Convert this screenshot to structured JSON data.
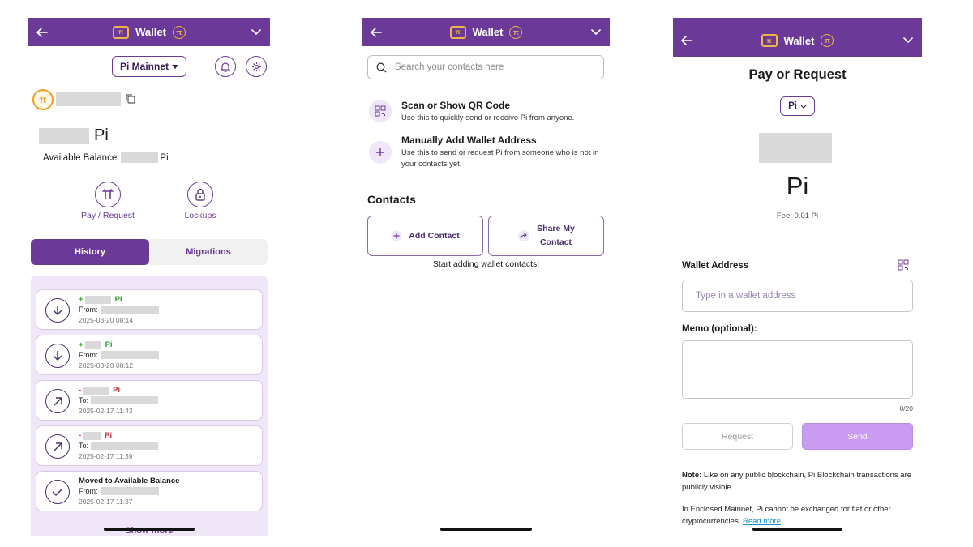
{
  "header": {
    "title": "Wallet",
    "logo_text": "π"
  },
  "panel1": {
    "network": "Pi Mainnet",
    "avatar_symbol": "π",
    "balance_unit": "Pi",
    "available_label": "Available Balance:",
    "available_unit": "Pi",
    "actions": {
      "pay": "Pay / Request",
      "lockups": "Lockups"
    },
    "tabs": {
      "history": "History",
      "migrations": "Migrations"
    },
    "history": [
      {
        "sign": "+",
        "unit": "Pi",
        "party_label": "From:",
        "date": "2025-03-20 08:14",
        "direction": "in"
      },
      {
        "sign": "+",
        "unit": "Pi",
        "party_label": "From:",
        "date": "2025-03-20 08:12",
        "direction": "in"
      },
      {
        "sign": "-",
        "unit": "Pi",
        "party_label": "To:",
        "date": "2025-02-17 11:43",
        "direction": "out"
      },
      {
        "sign": "-",
        "unit": "Pi",
        "party_label": "To:",
        "date": "2025-02-17 11:39",
        "direction": "out"
      },
      {
        "title": "Moved to Available Balance",
        "party_label": "From:",
        "date": "2025-02-17 11:37",
        "direction": "moved"
      }
    ],
    "show_more": "Show more"
  },
  "panel2": {
    "search_placeholder": "Search your contacts here",
    "scan": {
      "title": "Scan or Show QR Code",
      "desc": "Use this to quickly send or receive Pi from anyone."
    },
    "manual": {
      "title": "Manually Add Wallet Address",
      "desc": "Use this to send or request Pi from someone who is not in your contacts yet."
    },
    "contacts_heading": "Contacts",
    "add_contact": "Add Contact",
    "share_line1": "Share My",
    "share_line2": "Contact",
    "empty_text": "Start adding wallet contacts!"
  },
  "panel3": {
    "heading": "Pay or Request",
    "currency": "Pi",
    "pi_big": "Pi",
    "fee_label": "Fee:",
    "fee_value": "0.01",
    "fee_unit": "Pi",
    "wallet_label": "Wallet Address",
    "wallet_placeholder": "Type in a wallet address",
    "memo_label": "Memo (optional):",
    "memo_counter": "0/20",
    "request_btn": "Request",
    "send_btn": "Send",
    "note_bold": "Note:",
    "note_text": " Like on any public blockchain, Pi Blockchain transactions are publicly visible",
    "enclosed_text": "In Enclosed Mainnet, Pi cannot be exchanged for fiat or other cryptocurrencies. ",
    "read_more": "Read more"
  },
  "colors": {
    "brand": "#6b3a99",
    "accent": "#f0b24a",
    "positive": "#2a9d2a",
    "negative": "#d32f2f",
    "send": "#c99cf2"
  }
}
